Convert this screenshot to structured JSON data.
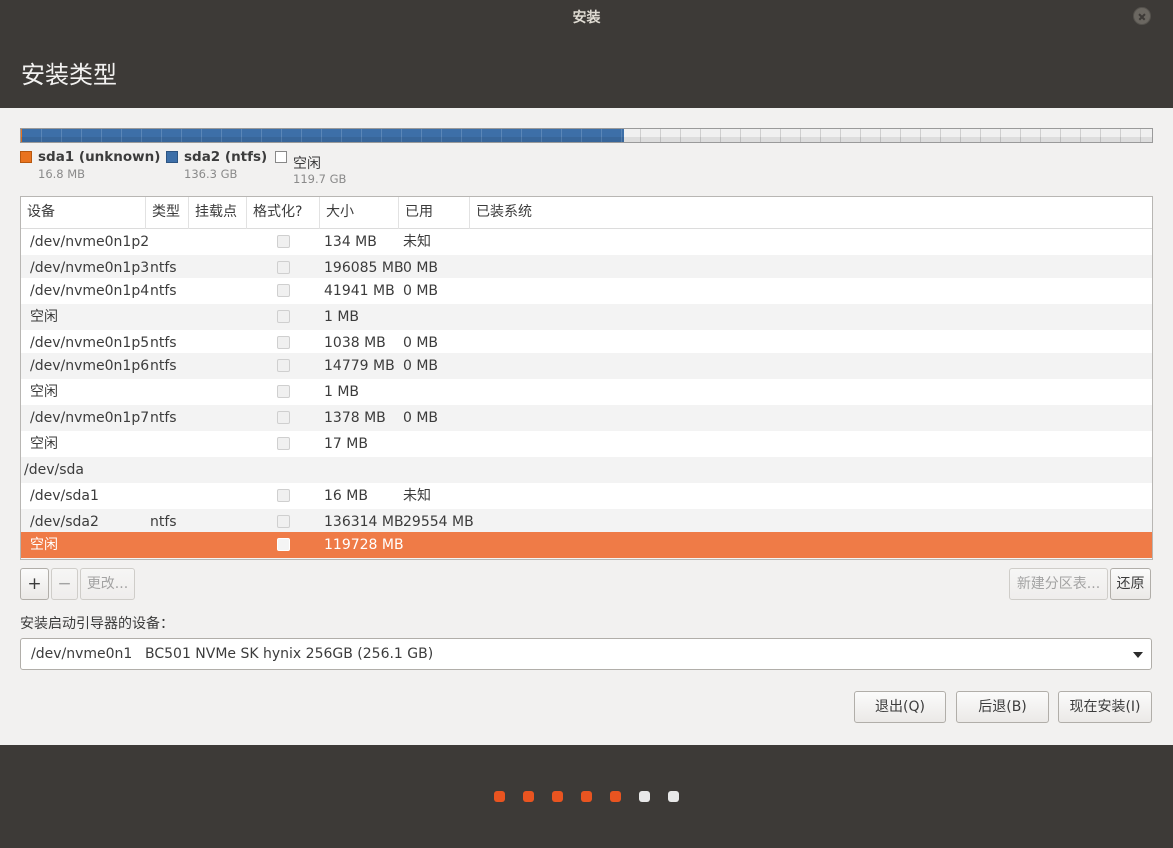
{
  "window": {
    "title": "安装"
  },
  "page": {
    "title": "安装类型"
  },
  "partition_bar": {
    "colors": {
      "unknown": "#e9731f",
      "ntfs": "#3d6fa8",
      "free": "#f0f0f0"
    },
    "legend": [
      {
        "name": "sda1 (unknown)",
        "size": "16.8 MB",
        "color": "#e9731f"
      },
      {
        "name": "sda2 (ntfs)",
        "size": "136.3 GB",
        "color": "#3d6fa8"
      },
      {
        "name": "空闲",
        "size": "119.7 GB",
        "color": "#ffffff"
      }
    ]
  },
  "table": {
    "headers": [
      "设备",
      "类型",
      "挂载点",
      "格式化?",
      "大小",
      "已用",
      "已装系统"
    ],
    "rows": [
      {
        "device": "/dev/nvme0n1p2",
        "type": "",
        "mount": "",
        "size": "134 MB",
        "used": "未知",
        "system": ""
      },
      {
        "device": "/dev/nvme0n1p3",
        "type": "ntfs",
        "mount": "",
        "size": "196085 MB",
        "used": "0 MB",
        "system": ""
      },
      {
        "device": "/dev/nvme0n1p4",
        "type": "ntfs",
        "mount": "",
        "size": "41941 MB",
        "used": "0 MB",
        "system": ""
      },
      {
        "device": "空闲",
        "type": "",
        "mount": "",
        "size": "1 MB",
        "used": "",
        "system": ""
      },
      {
        "device": "/dev/nvme0n1p5",
        "type": "ntfs",
        "mount": "",
        "size": "1038 MB",
        "used": "0 MB",
        "system": ""
      },
      {
        "device": "/dev/nvme0n1p6",
        "type": "ntfs",
        "mount": "",
        "size": "14779 MB",
        "used": "0 MB",
        "system": ""
      },
      {
        "device": "空闲",
        "type": "",
        "mount": "",
        "size": "1 MB",
        "used": "",
        "system": ""
      },
      {
        "device": "/dev/nvme0n1p7",
        "type": "ntfs",
        "mount": "",
        "size": "1378 MB",
        "used": "0 MB",
        "system": ""
      },
      {
        "device": "空闲",
        "type": "",
        "mount": "",
        "size": "17 MB",
        "used": "",
        "system": ""
      },
      {
        "device": "/dev/sda",
        "type": "",
        "mount": "",
        "size": "",
        "used": "",
        "system": ""
      },
      {
        "device": "/dev/sda1",
        "type": "",
        "mount": "",
        "size": "16 MB",
        "used": "未知",
        "system": ""
      },
      {
        "device": "/dev/sda2",
        "type": "ntfs",
        "mount": "",
        "size": "136314 MB",
        "used": "29554 MB",
        "system": ""
      },
      {
        "device": "空闲",
        "type": "",
        "mount": "",
        "size": "119728 MB",
        "used": "",
        "system": ""
      }
    ]
  },
  "toolbar": {
    "add": "+",
    "remove": "−",
    "change": "更改...",
    "new_table": "新建分区表...",
    "revert": "还原"
  },
  "bootloader": {
    "label": "安装启动引导器的设备：",
    "device": "/dev/nvme0n1",
    "model": "BC501 NVMe SK hynix 256GB (256.1 GB)"
  },
  "buttons": {
    "quit": "退出(Q)",
    "back": "后退(B)",
    "install_now": "现在安装(I)"
  },
  "progress": {
    "completed_steps": 5,
    "total_steps": 7,
    "colors": {
      "done": "#e95420",
      "todo": "#e8e8e8"
    }
  }
}
